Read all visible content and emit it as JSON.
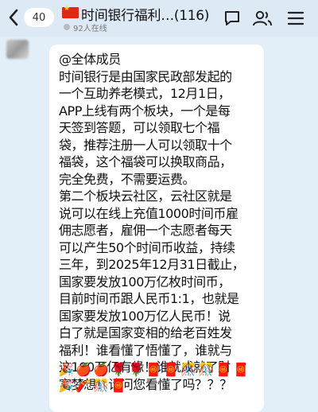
{
  "header": {
    "unread_count": "40",
    "group_title": "时间银行福利…(116)",
    "online_status": "92人在线"
  },
  "message": {
    "lines": [
      "@全体成员",
      "时间银行是由国家民政部发起的",
      "一个互助养老模式，12月1日，",
      "APP上线有两个板块，一个是每",
      "天签到答题，可以领取七个福",
      "袋，推荐注册一人可以领取十个",
      "福袋，这个福袋可以换取商品，",
      "完全免费，不需要运费。",
      "第二个板块云社区，云社区就是",
      "说可以在线上充值1000时间币雇",
      "佣志愿者，雇佣一个志愿者每天",
      "可以产生50个时间币收益，持续",
      "三年，到2025年12月31日截止，",
      "国家要发放100万亿枚时间币，",
      "目前时间币跟人民币1:1，也就是",
      "国家要发放100万亿人民币！说",
      "白了就是国家变相的给老百姓发",
      "福利！谁看懂了悟懂了，谁就与",
      "这100万亿有缘！谁就成就了财",
      "富梦想！请问您看懂了吗？？？"
    ],
    "emojis": [
      "🎉",
      "🍎",
      "🍎",
      "🌹",
      "🌹",
      "🧧",
      "🧧",
      "🎊",
      "🎊",
      "🧧",
      "🧧",
      "🎉",
      "🧨",
      "🎊",
      "🧧"
    ]
  },
  "colors": {
    "header_bg": "#dde9f5",
    "chat_bg": "#e2eef8",
    "bubble_bg": "#ffffff",
    "flag_red": "#de2910"
  }
}
